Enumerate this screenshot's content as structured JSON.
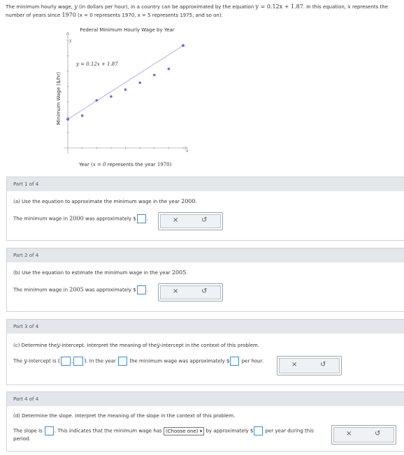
{
  "intro": {
    "line1_a": "The minimum hourly wage,",
    "var_y": "y",
    "line1_b": "(in dollars per hour), in a country can be approximated by the equation",
    "equation": "y = 0.12x + 1.87",
    "line1_c": ". In this equation,",
    "var_x": "x",
    "line1_d": "represents the",
    "line2_a": "number of years since",
    "year1970": "1970",
    "line2_b": "(x = 0 represents 1970, x = 5 represents 1975, and so on)."
  },
  "chart": {
    "title": "Federal Minimum Hourly Wage by Year",
    "ylabel": "Minimum Wage ($/hr)",
    "xlabel_a": "Year (",
    "xlabel_b": "x = 0",
    "xlabel_c": "represents the year",
    "xlabel_d": "1970)",
    "eq_label": "y = 0.12x + 1.87",
    "axis_y_letter": "y",
    "axis_x_letter": "x",
    "point_color": "#6b6bef",
    "line_color": "#9fa6e8"
  },
  "chart_data": {
    "type": "scatter",
    "title": "Federal Minimum Hourly Wage by Year",
    "xlabel": "Year (x = 0 represents the year 1970)",
    "ylabel": "Minimum Wage ($/hr)",
    "xlim": [
      0,
      40
    ],
    "ylim": [
      0,
      7
    ],
    "points": {
      "x": [
        0,
        5,
        10,
        15,
        20,
        25,
        30,
        35
      ],
      "y": [
        1.6,
        2.1,
        3.1,
        3.35,
        3.8,
        4.25,
        4.75,
        5.15
      ]
    },
    "trend_line": {
      "slope": 0.12,
      "intercept": 1.87,
      "x": [
        0,
        40
      ]
    }
  },
  "parts": [
    {
      "head": "Part 1 of 4",
      "question_a": "(a) Use the equation to approximate the minimum wage in the year",
      "question_year": "2000",
      "answer_a": "The minimum wage in",
      "answer_year": "2000",
      "answer_b": "was approximately $"
    },
    {
      "head": "Part 2 of 4",
      "question_a": "(b) Use the equation to estimate the minimum wage in the year",
      "question_year": "2005",
      "answer_a": "The minimum wage in",
      "answer_year": "2005",
      "answer_b": "was approximately $"
    },
    {
      "head": "Part 3 of 4",
      "question_a": "(c) Determine the",
      "question_b": "-intercept. Interpret the meaning of the",
      "question_c": "-intercept in the context of this problem.",
      "answer_a": "The",
      "answer_b": "-intercept is",
      "answer_c": ". In the year",
      "answer_d": "the minimum wage was approximately $",
      "answer_e": "per hour."
    },
    {
      "head": "Part 4 of 4",
      "question_a": "(d) Determine the slope. Interpret the meaning of the slope in the context of this problem.",
      "answer_a": "The slope is",
      "answer_b": ". This indicates that the minimum wage has",
      "select_value": "(Choose one)",
      "answer_c": "by approximately $",
      "answer_d": "per year during this",
      "answer_e": "period."
    }
  ],
  "buttons": {
    "clear": "×",
    "undo": "↺"
  }
}
